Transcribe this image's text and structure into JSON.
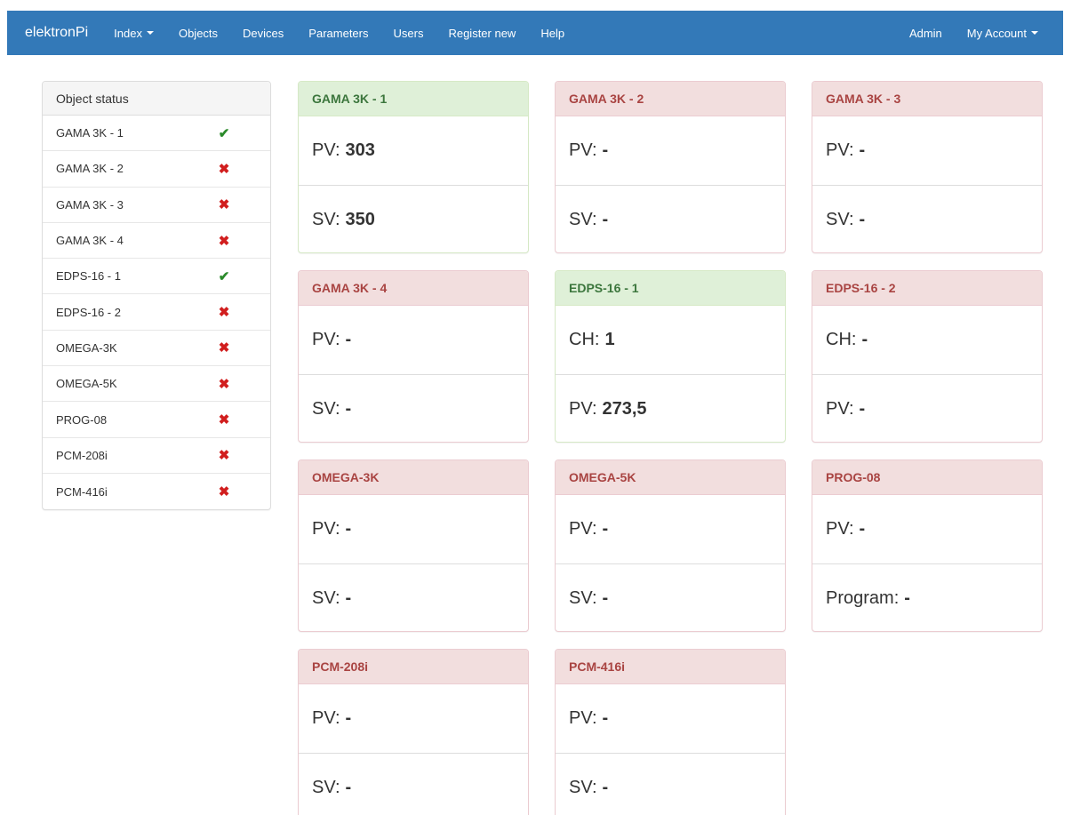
{
  "navbar": {
    "brand": "elektronPi",
    "left_items": [
      "Index",
      "Objects",
      "Devices",
      "Parameters",
      "Users",
      "Register new",
      "Help"
    ],
    "right_items": [
      "Admin",
      "My Account"
    ]
  },
  "sidebar": {
    "title": "Object status",
    "items": [
      {
        "name": "GAMA 3K - 1",
        "status": "ok",
        "icon": "check-icon"
      },
      {
        "name": "GAMA 3K - 2",
        "status": "error",
        "icon": "cross-icon"
      },
      {
        "name": "GAMA 3K - 3",
        "status": "error",
        "icon": "cross-icon"
      },
      {
        "name": "GAMA 3K - 4",
        "status": "error",
        "icon": "cross-icon"
      },
      {
        "name": "EDPS-16 - 1",
        "status": "ok",
        "icon": "check-icon"
      },
      {
        "name": "EDPS-16 - 2",
        "status": "error",
        "icon": "cross-icon"
      },
      {
        "name": "OMEGA-3K",
        "status": "error",
        "icon": "cross-icon"
      },
      {
        "name": "OMEGA-5K",
        "status": "error",
        "icon": "cross-icon"
      },
      {
        "name": "PROG-08",
        "status": "error",
        "icon": "cross-icon"
      },
      {
        "name": "PCM-208i",
        "status": "error",
        "icon": "cross-icon"
      },
      {
        "name": "PCM-416i",
        "status": "error",
        "icon": "cross-icon"
      }
    ]
  },
  "cards": [
    {
      "title": "GAMA 3K - 1",
      "state": "success",
      "rows": [
        {
          "label": "PV:",
          "value": "303"
        },
        {
          "label": "SV:",
          "value": "350"
        }
      ]
    },
    {
      "title": "GAMA 3K - 2",
      "state": "danger",
      "rows": [
        {
          "label": "PV:",
          "value": "-"
        },
        {
          "label": "SV:",
          "value": "-"
        }
      ]
    },
    {
      "title": "GAMA 3K - 3",
      "state": "danger",
      "rows": [
        {
          "label": "PV:",
          "value": "-"
        },
        {
          "label": "SV:",
          "value": "-"
        }
      ]
    },
    {
      "title": "GAMA 3K - 4",
      "state": "danger",
      "rows": [
        {
          "label": "PV:",
          "value": "-"
        },
        {
          "label": "SV:",
          "value": "-"
        }
      ]
    },
    {
      "title": "EDPS-16 - 1",
      "state": "success",
      "rows": [
        {
          "label": "CH:",
          "value": "1"
        },
        {
          "label": "PV:",
          "value": "273,5"
        }
      ]
    },
    {
      "title": "EDPS-16 - 2",
      "state": "danger",
      "rows": [
        {
          "label": "CH:",
          "value": "-"
        },
        {
          "label": "PV:",
          "value": "-"
        }
      ]
    },
    {
      "title": "OMEGA-3K",
      "state": "danger",
      "rows": [
        {
          "label": "PV:",
          "value": "-"
        },
        {
          "label": "SV:",
          "value": "-"
        }
      ]
    },
    {
      "title": "OMEGA-5K",
      "state": "danger",
      "rows": [
        {
          "label": "PV:",
          "value": "-"
        },
        {
          "label": "SV:",
          "value": "-"
        }
      ]
    },
    {
      "title": "PROG-08",
      "state": "danger",
      "rows": [
        {
          "label": "PV:",
          "value": "-"
        },
        {
          "label": "Program:",
          "value": "-"
        }
      ]
    },
    {
      "title": "PCM-208i",
      "state": "danger",
      "rows": [
        {
          "label": "PV:",
          "value": "-"
        },
        {
          "label": "SV:",
          "value": "-"
        }
      ]
    },
    {
      "title": "PCM-416i",
      "state": "danger",
      "rows": [
        {
          "label": "PV:",
          "value": "-"
        },
        {
          "label": "SV:",
          "value": "-"
        }
      ]
    }
  ],
  "colors": {
    "navbar": "#3379b8",
    "ok": "#2a8a2a",
    "error": "#d11e1e",
    "success_heading_bg": "#dff0d8",
    "danger_heading_bg": "#f2dede"
  }
}
